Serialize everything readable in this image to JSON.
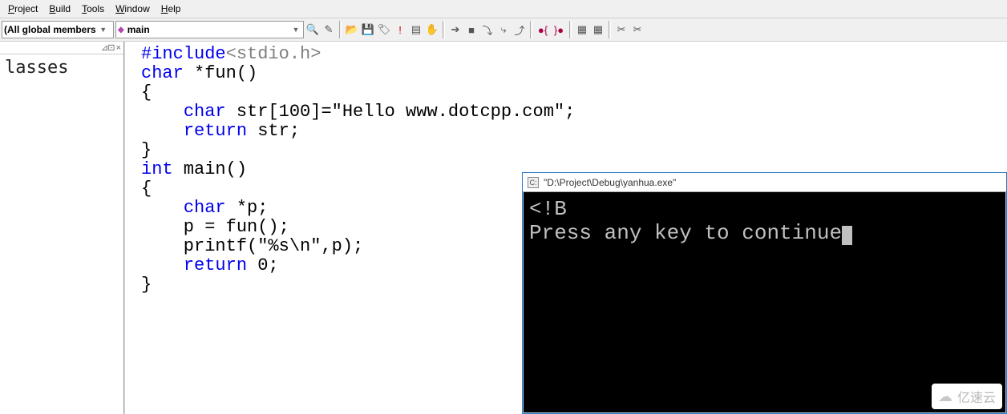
{
  "menu": {
    "project": "Project",
    "build": "Build",
    "tools": "Tools",
    "window": "Window",
    "help": "Help"
  },
  "toolbar": {
    "scope_label": "(All global members",
    "function_label": "main",
    "icons": {
      "search": "search-icon",
      "wand": "wand-icon",
      "open": "open-icon",
      "save": "save-icon",
      "tag": "tag-icon",
      "excl": "excl-icon",
      "sheet": "sheet-icon",
      "hand": "hand-icon",
      "run": "run-icon",
      "stop": "stop-icon",
      "step1": "step-icon",
      "step2": "step-icon",
      "step3": "step-icon",
      "bp1": "breakpoint-icon",
      "bp2": "breakpoint-icon",
      "grid1": "grid-icon",
      "grid2": "grid-icon",
      "x1": "x-icon",
      "x2": "x-icon"
    }
  },
  "sidebar": {
    "header_controls": "⊿⊡ ×",
    "title": "lasses"
  },
  "code": {
    "lines": [
      {
        "fragments": [
          {
            "cls": "kw",
            "t": "#include"
          },
          {
            "cls": "gray",
            "t": "<stdio.h>"
          }
        ]
      },
      {
        "fragments": [
          {
            "cls": "kw",
            "t": "char"
          },
          {
            "cls": "txt",
            "t": " *fun()"
          }
        ]
      },
      {
        "fragments": [
          {
            "cls": "txt",
            "t": "{"
          }
        ]
      },
      {
        "fragments": [
          {
            "cls": "txt",
            "t": "    "
          },
          {
            "cls": "kw",
            "t": "char"
          },
          {
            "cls": "txt",
            "t": " str[100]=\"Hello www.dotcpp.com\";"
          }
        ]
      },
      {
        "fragments": [
          {
            "cls": "txt",
            "t": "    "
          },
          {
            "cls": "kw",
            "t": "return"
          },
          {
            "cls": "txt",
            "t": " str;"
          }
        ]
      },
      {
        "fragments": [
          {
            "cls": "txt",
            "t": "}"
          }
        ]
      },
      {
        "fragments": [
          {
            "cls": "kw",
            "t": "int"
          },
          {
            "cls": "txt",
            "t": " main()"
          }
        ]
      },
      {
        "fragments": [
          {
            "cls": "txt",
            "t": "{"
          }
        ]
      },
      {
        "fragments": [
          {
            "cls": "txt",
            "t": "    "
          },
          {
            "cls": "kw",
            "t": "char"
          },
          {
            "cls": "txt",
            "t": " *p;"
          }
        ]
      },
      {
        "fragments": [
          {
            "cls": "txt",
            "t": "    p = fun();"
          }
        ]
      },
      {
        "fragments": [
          {
            "cls": "txt",
            "t": "    printf(\"%s\\n\",p);"
          }
        ]
      },
      {
        "fragments": [
          {
            "cls": "txt",
            "t": "    "
          },
          {
            "cls": "kw",
            "t": "return"
          },
          {
            "cls": "txt",
            "t": " 0;"
          }
        ]
      },
      {
        "fragments": [
          {
            "cls": "txt",
            "t": "}"
          }
        ]
      }
    ]
  },
  "console": {
    "title": "\"D:\\Project\\Debug\\yanhua.exe\"",
    "line1": "<!B",
    "line2": "Press any key to continue"
  },
  "watermark": {
    "text": "亿速云"
  }
}
